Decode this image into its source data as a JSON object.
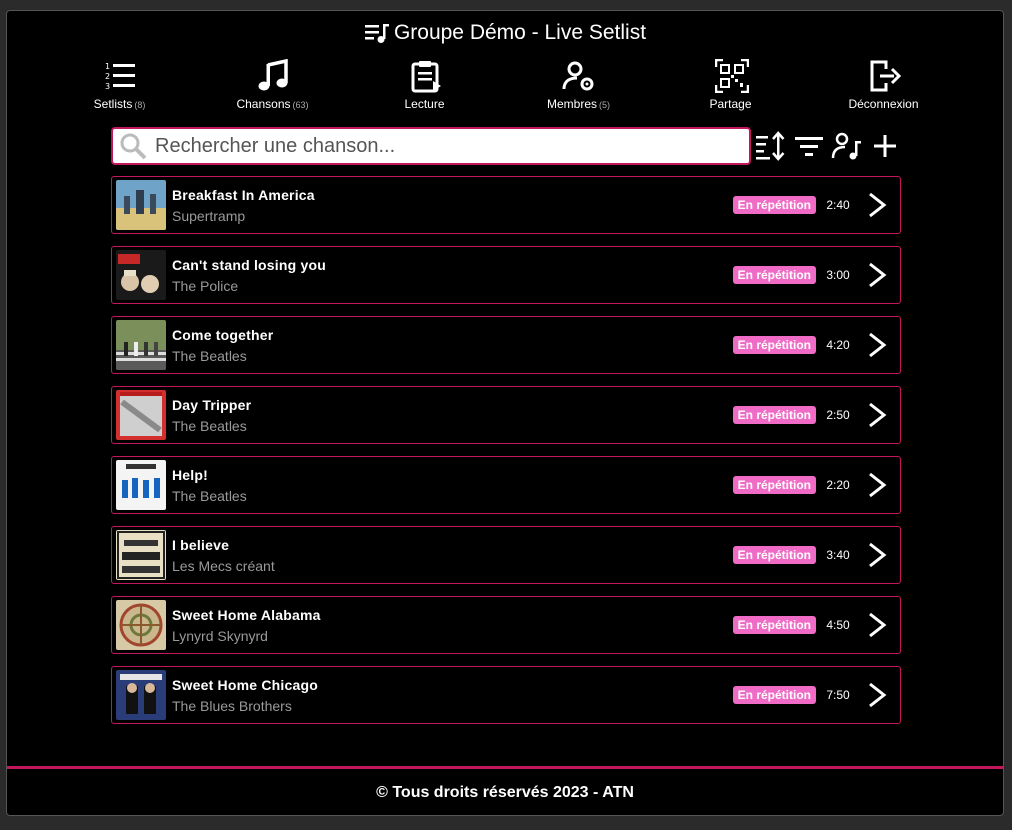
{
  "header": {
    "title": "Groupe Démo - Live Setlist"
  },
  "nav": [
    {
      "label": "Setlists",
      "count": "(8)",
      "icon": "numbered-list-icon"
    },
    {
      "label": "Chansons",
      "count": "(63)",
      "icon": "music-note-icon"
    },
    {
      "label": "Lecture",
      "count": "",
      "icon": "clipboard-play-icon"
    },
    {
      "label": "Membres",
      "count": "(5)",
      "icon": "user-gear-icon"
    },
    {
      "label": "Partage",
      "count": "",
      "icon": "qr-code-icon"
    },
    {
      "label": "Déconnexion",
      "count": "",
      "icon": "logout-icon"
    }
  ],
  "search": {
    "placeholder": "Rechercher une chanson..."
  },
  "songs": [
    {
      "title": "Breakfast In America",
      "artist": "Supertramp",
      "status": "En répétition",
      "duration": "2:40"
    },
    {
      "title": "Can't stand losing you",
      "artist": "The Police",
      "status": "En répétition",
      "duration": "3:00"
    },
    {
      "title": "Come together",
      "artist": "The Beatles",
      "status": "En répétition",
      "duration": "4:20"
    },
    {
      "title": "Day Tripper",
      "artist": "The Beatles",
      "status": "En répétition",
      "duration": "2:50"
    },
    {
      "title": "Help!",
      "artist": "The Beatles",
      "status": "En répétition",
      "duration": "2:20"
    },
    {
      "title": "I believe",
      "artist": "Les Mecs créant",
      "status": "En répétition",
      "duration": "3:40"
    },
    {
      "title": "Sweet Home Alabama",
      "artist": "Lynyrd Skynyrd",
      "status": "En répétition",
      "duration": "4:50"
    },
    {
      "title": "Sweet Home Chicago",
      "artist": "The Blues Brothers",
      "status": "En répétition",
      "duration": "7:50"
    }
  ],
  "footer": {
    "text": "© Tous droits réservés 2023 - ATN"
  },
  "colors": {
    "accent": "#c2185b",
    "badge": "#f06bc5",
    "background": "#000000"
  }
}
